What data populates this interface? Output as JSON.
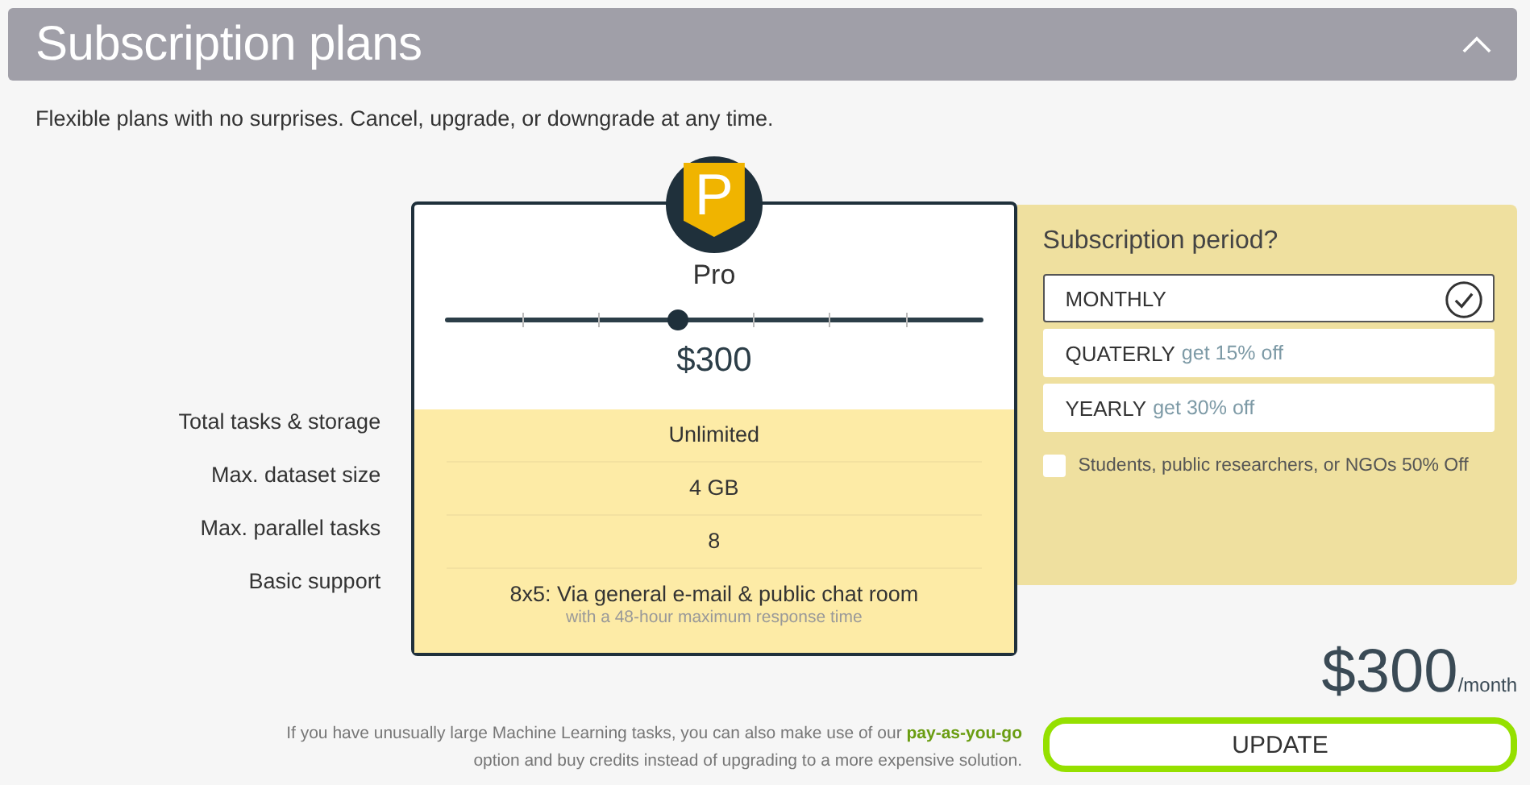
{
  "header": {
    "title": "Subscription plans",
    "expanded": true
  },
  "description": "Flexible plans with no surprises. Cancel, upgrade, or downgrade at any time.",
  "plan": {
    "badge": "P",
    "name": "Pro",
    "level": 0.43,
    "price": "$300"
  },
  "features": [
    {
      "label": "Total tasks & storage",
      "value": "Unlimited"
    },
    {
      "label": "Max. dataset size",
      "value": "4 GB"
    },
    {
      "label": "Max. parallel tasks",
      "value": "8"
    },
    {
      "label": "Basic support",
      "value": "8x5: Via general e-mail & public chat room",
      "note": "with a 48-hour maximum response time"
    }
  ],
  "period": {
    "title": "Subscription period?",
    "options": [
      {
        "label": "MONTHLY",
        "selected": true
      },
      {
        "label": "QUATERLY",
        "discount": "get 15% off",
        "selected": false
      },
      {
        "label": "YEARLY",
        "discount": "get 30% off",
        "selected": false
      }
    ],
    "discount_checkbox": {
      "label": "Students, public researchers, or NGOs 50% Off",
      "checked": false
    }
  },
  "total": {
    "amount": "$300",
    "unit": "/month"
  },
  "footnote": {
    "before": "If you have unusually large Machine Learning tasks, you can also make use of our",
    "link": "pay-as-you-go",
    "after": "option and buy credits instead of upgrading to a more expensive solution."
  },
  "update_button": "UPDATE"
}
